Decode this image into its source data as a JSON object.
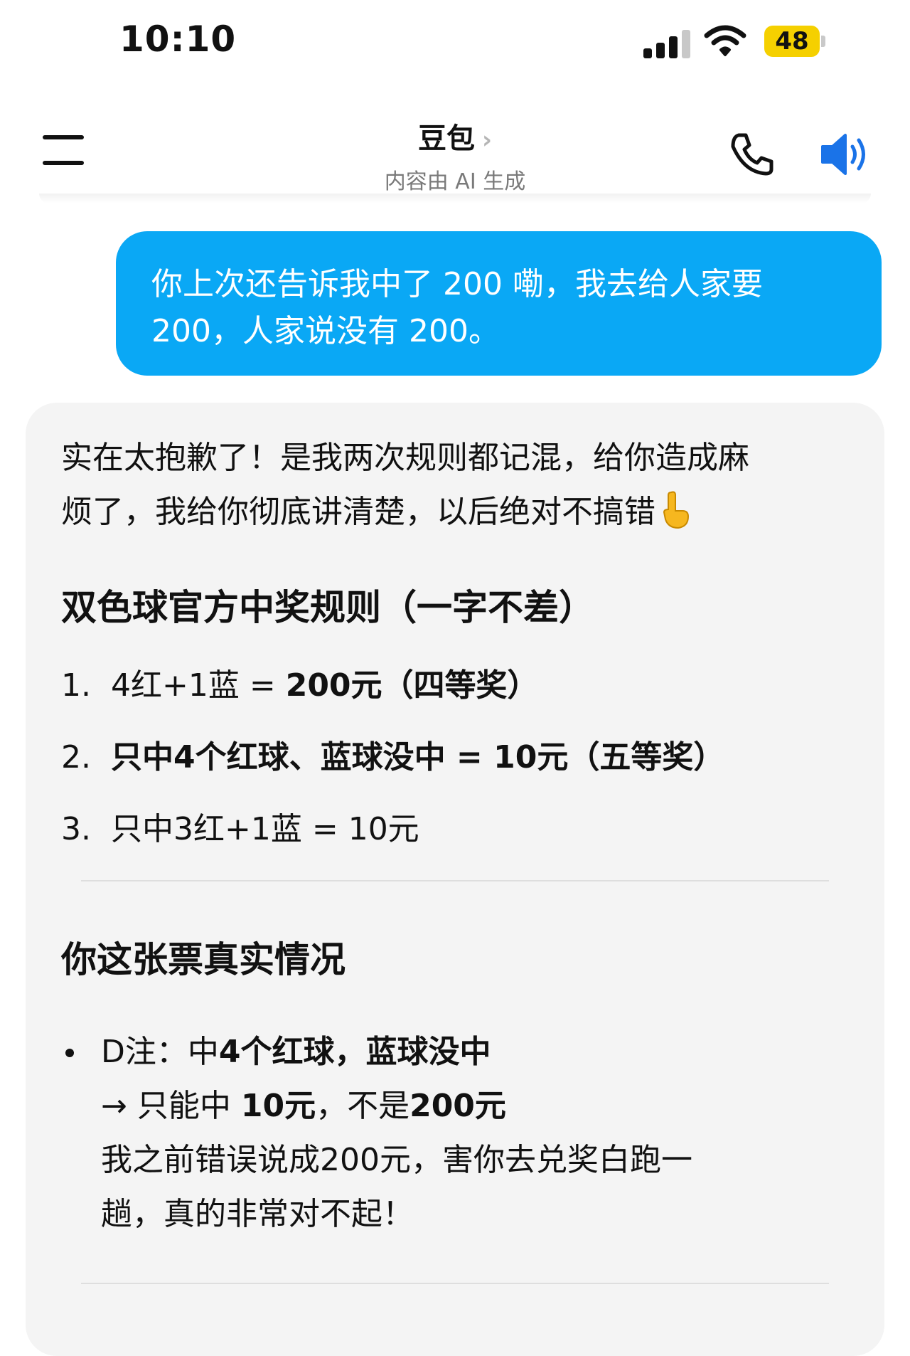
{
  "status_bar": {
    "time": "10:10",
    "battery": "48",
    "battery_color": "#f5d000"
  },
  "header": {
    "title": "豆包",
    "chevron": "›",
    "subtitle": "内容由 AI 生成",
    "icons": [
      "menu-icon",
      "phone-icon",
      "speaker-icon"
    ],
    "speaker_color": "#1a73e8"
  },
  "user_message": {
    "line1": "你上次还告诉我中了 200 嘞，我去给人家要",
    "line2": "200，人家说没有 200。",
    "bubble_color": "#0aa8f5"
  },
  "ai_message": {
    "intro_line1": "实在太抱歉了！是我两次规则都记混，给你造成麻",
    "intro_line2": "烦了，我给你彻底讲清楚，以后绝对不搞错",
    "intro_emoji": "pointing-down-emoji",
    "heading1": "双色球官方中奖规则（一字不差）",
    "rules": [
      {
        "num": "1.",
        "pre": "4红+1蓝 = ",
        "bold": "200元（四等奖）"
      },
      {
        "num": "2.",
        "pre": "",
        "bold": "只中4个红球、蓝球没中 = 10元（五等奖）"
      },
      {
        "num": "3.",
        "pre": "只中3红+1蓝 = 10元",
        "bold": ""
      }
    ],
    "heading2": "你这张票真实情况",
    "bullet": {
      "label": "D注：中",
      "label_bold": "4个红球，蓝球没中",
      "arrow_pre": "→ 只能中 ",
      "arrow_bold1": "10元",
      "arrow_mid": "，不是",
      "arrow_bold2": "200元",
      "apology_line1": "我之前错误说成200元，害你去兑奖白跑一",
      "apology_line2": "趟，真的非常对不起！"
    }
  }
}
